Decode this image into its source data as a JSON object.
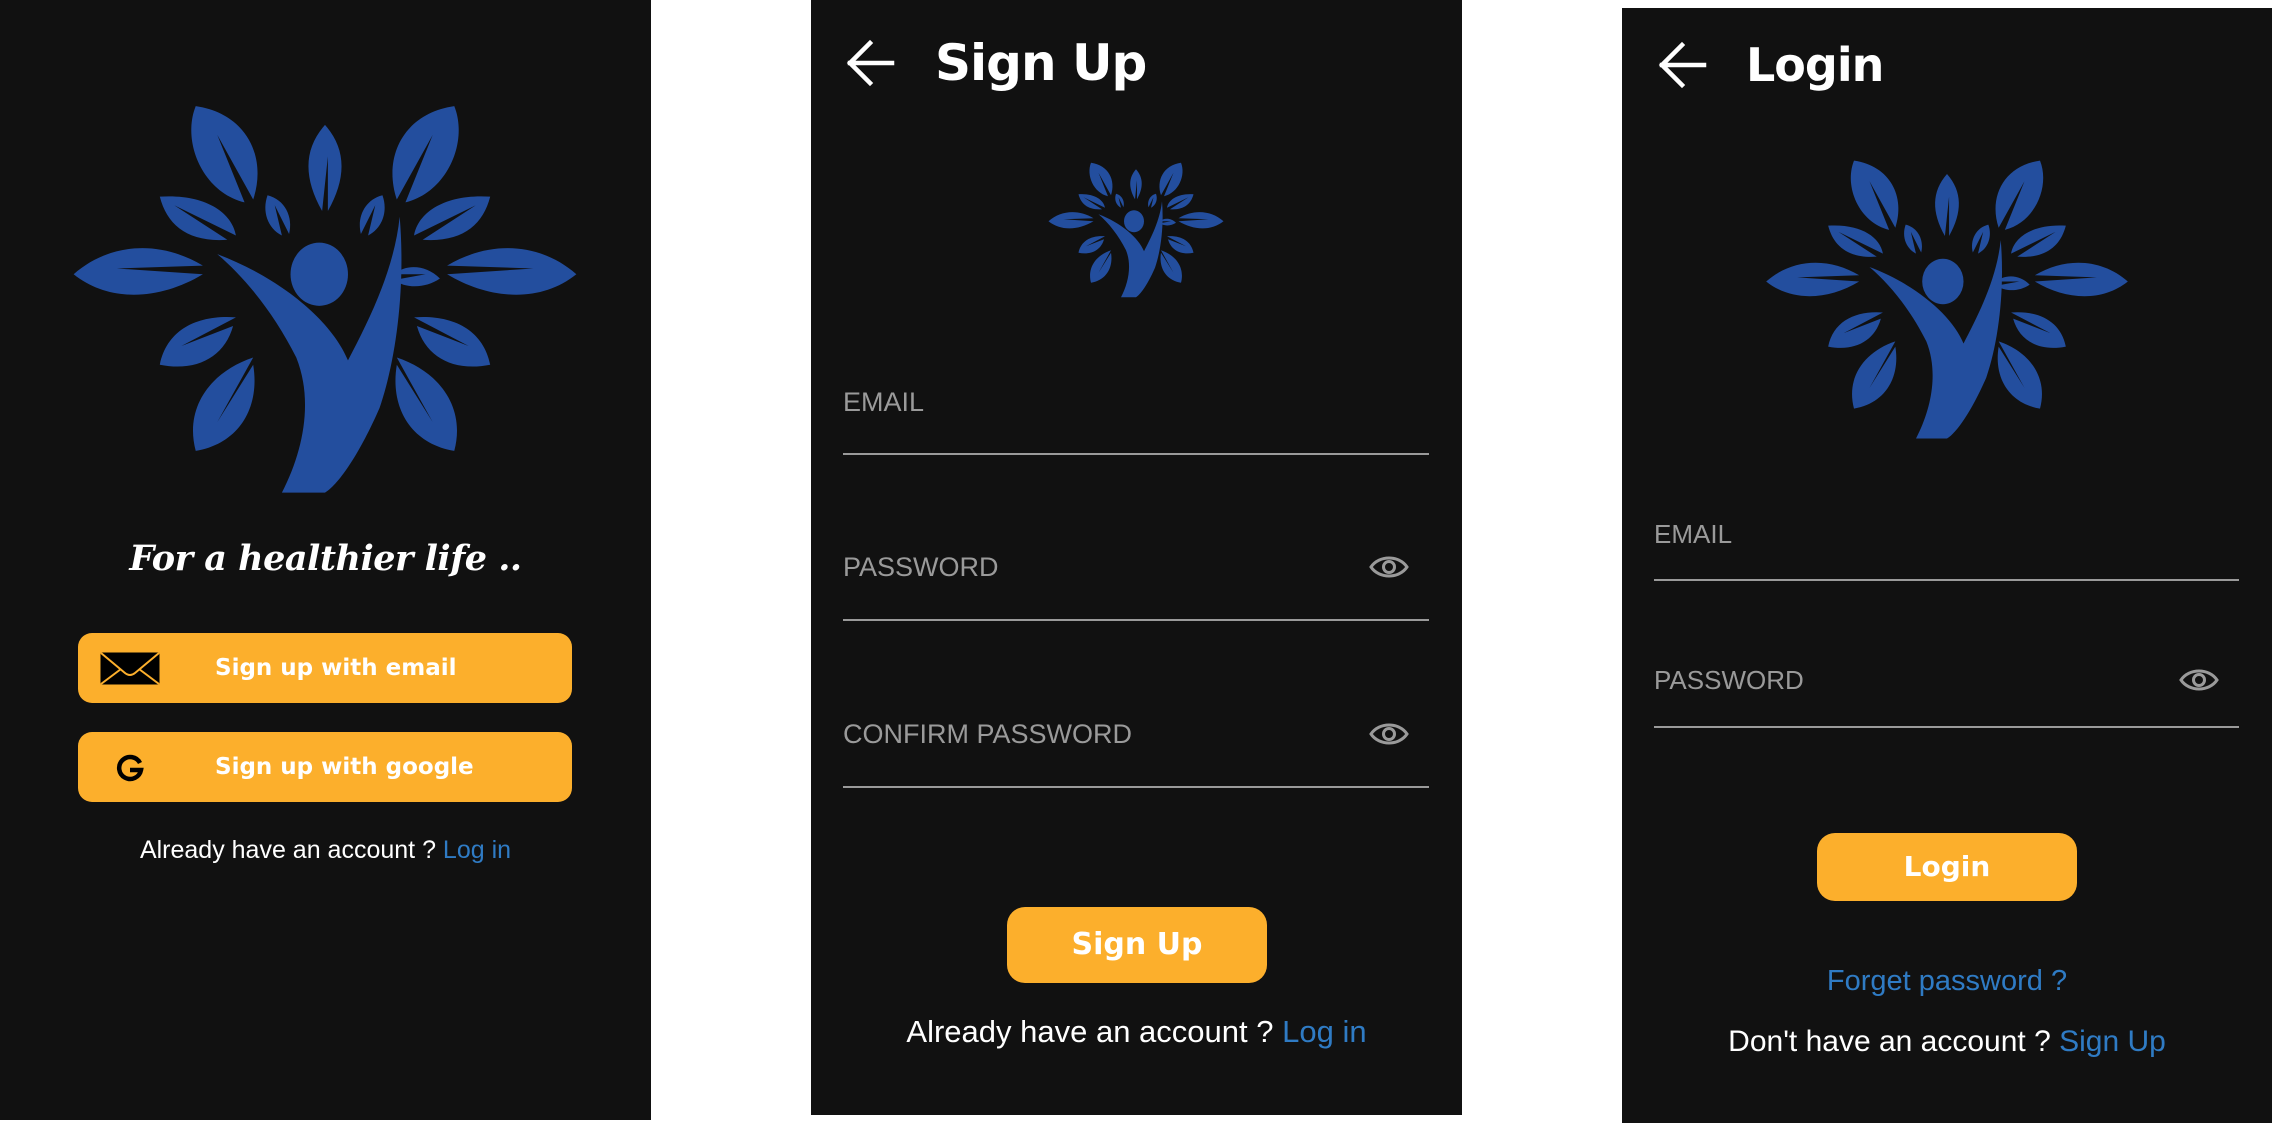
{
  "colors": {
    "background": "#111111",
    "brand_blue": "#234E9E",
    "accent_button": "#FCAF2C",
    "link": "#2F7BC4",
    "field_label": "#9a9a9a"
  },
  "welcome": {
    "logo_icon": "tree-person-logo",
    "tagline": "For a healthier life ..",
    "buttons": [
      {
        "icon": "envelope-icon",
        "label": "Sign up with email"
      },
      {
        "icon": "google-icon",
        "label": "Sign up with google"
      }
    ],
    "footer": {
      "text": "Already have an account ? ",
      "link": "Log in"
    }
  },
  "signup": {
    "back_icon": "arrow-left-icon",
    "title": "Sign Up",
    "logo_icon": "tree-person-logo",
    "fields": [
      {
        "label": "EMAIL",
        "value": "",
        "has_eye": false
      },
      {
        "label": "PASSWORD",
        "value": "",
        "has_eye": true
      },
      {
        "label": "CONFIRM PASSWORD",
        "value": "",
        "has_eye": true
      }
    ],
    "submit_label": "Sign Up",
    "footer": {
      "text": "Already have an account ? ",
      "link": "Log in"
    }
  },
  "login": {
    "back_icon": "arrow-left-icon",
    "title": "Login",
    "logo_icon": "tree-person-logo",
    "fields": [
      {
        "label": "EMAIL",
        "value": "",
        "has_eye": false
      },
      {
        "label": "PASSWORD",
        "value": "",
        "has_eye": true
      }
    ],
    "submit_label": "Login",
    "forgot_label": "Forget password ?",
    "footer": {
      "text": "Don't have an account ? ",
      "link": "Sign Up"
    }
  }
}
